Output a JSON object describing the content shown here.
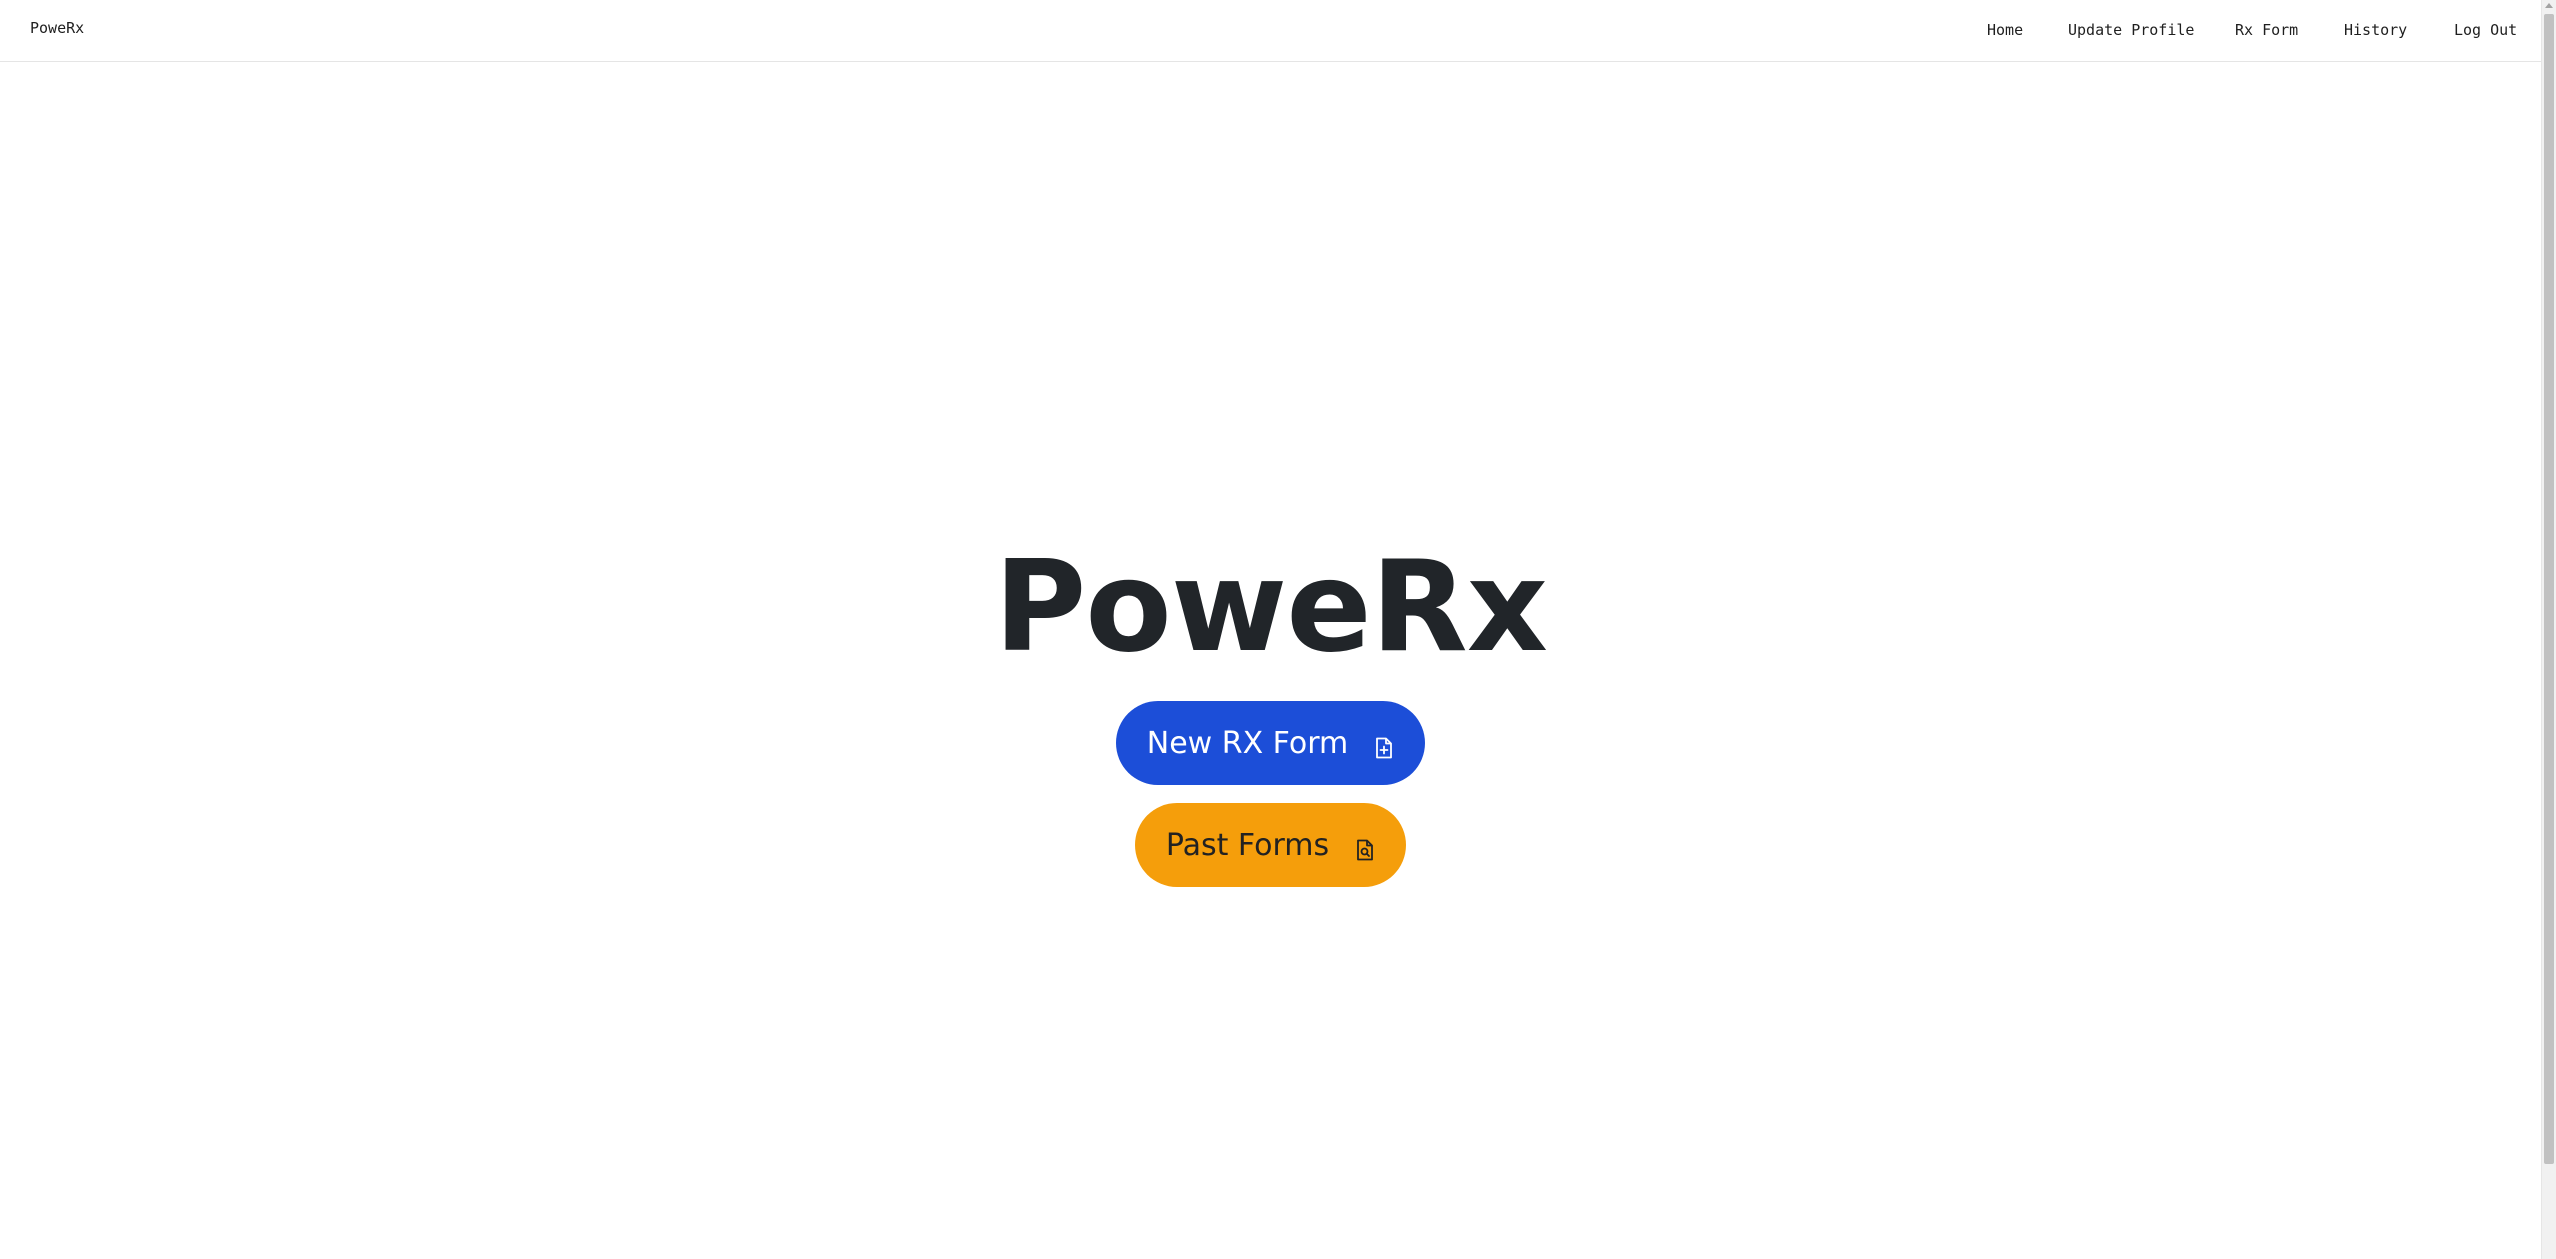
{
  "navbar": {
    "brand": "PoweRx",
    "links": {
      "home": "Home",
      "update_profile": "Update Profile",
      "rx_form": "Rx Form",
      "history": "History",
      "log_out": "Log Out"
    }
  },
  "hero": {
    "title": "PoweRx",
    "new_rx_button": {
      "label": "New RX Form",
      "icon": "file-plus-icon",
      "color": "#1c4ed8"
    },
    "past_forms_button": {
      "label": "Past Forms",
      "icon": "file-search-icon",
      "color": "#f59e0b"
    }
  }
}
